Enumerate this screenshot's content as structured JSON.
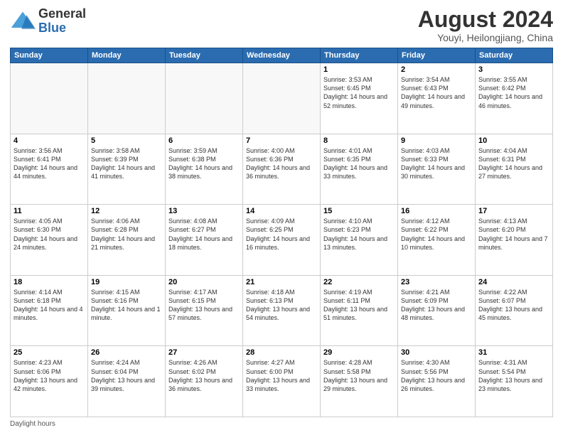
{
  "header": {
    "logo_general": "General",
    "logo_blue": "Blue",
    "month_year": "August 2024",
    "location": "Youyi, Heilongjiang, China"
  },
  "days_of_week": [
    "Sunday",
    "Monday",
    "Tuesday",
    "Wednesday",
    "Thursday",
    "Friday",
    "Saturday"
  ],
  "weeks": [
    [
      {
        "day": "",
        "info": ""
      },
      {
        "day": "",
        "info": ""
      },
      {
        "day": "",
        "info": ""
      },
      {
        "day": "",
        "info": ""
      },
      {
        "day": "1",
        "info": "Sunrise: 3:53 AM\nSunset: 6:45 PM\nDaylight: 14 hours and 52 minutes."
      },
      {
        "day": "2",
        "info": "Sunrise: 3:54 AM\nSunset: 6:43 PM\nDaylight: 14 hours and 49 minutes."
      },
      {
        "day": "3",
        "info": "Sunrise: 3:55 AM\nSunset: 6:42 PM\nDaylight: 14 hours and 46 minutes."
      }
    ],
    [
      {
        "day": "4",
        "info": "Sunrise: 3:56 AM\nSunset: 6:41 PM\nDaylight: 14 hours and 44 minutes."
      },
      {
        "day": "5",
        "info": "Sunrise: 3:58 AM\nSunset: 6:39 PM\nDaylight: 14 hours and 41 minutes."
      },
      {
        "day": "6",
        "info": "Sunrise: 3:59 AM\nSunset: 6:38 PM\nDaylight: 14 hours and 38 minutes."
      },
      {
        "day": "7",
        "info": "Sunrise: 4:00 AM\nSunset: 6:36 PM\nDaylight: 14 hours and 36 minutes."
      },
      {
        "day": "8",
        "info": "Sunrise: 4:01 AM\nSunset: 6:35 PM\nDaylight: 14 hours and 33 minutes."
      },
      {
        "day": "9",
        "info": "Sunrise: 4:03 AM\nSunset: 6:33 PM\nDaylight: 14 hours and 30 minutes."
      },
      {
        "day": "10",
        "info": "Sunrise: 4:04 AM\nSunset: 6:31 PM\nDaylight: 14 hours and 27 minutes."
      }
    ],
    [
      {
        "day": "11",
        "info": "Sunrise: 4:05 AM\nSunset: 6:30 PM\nDaylight: 14 hours and 24 minutes."
      },
      {
        "day": "12",
        "info": "Sunrise: 4:06 AM\nSunset: 6:28 PM\nDaylight: 14 hours and 21 minutes."
      },
      {
        "day": "13",
        "info": "Sunrise: 4:08 AM\nSunset: 6:27 PM\nDaylight: 14 hours and 18 minutes."
      },
      {
        "day": "14",
        "info": "Sunrise: 4:09 AM\nSunset: 6:25 PM\nDaylight: 14 hours and 16 minutes."
      },
      {
        "day": "15",
        "info": "Sunrise: 4:10 AM\nSunset: 6:23 PM\nDaylight: 14 hours and 13 minutes."
      },
      {
        "day": "16",
        "info": "Sunrise: 4:12 AM\nSunset: 6:22 PM\nDaylight: 14 hours and 10 minutes."
      },
      {
        "day": "17",
        "info": "Sunrise: 4:13 AM\nSunset: 6:20 PM\nDaylight: 14 hours and 7 minutes."
      }
    ],
    [
      {
        "day": "18",
        "info": "Sunrise: 4:14 AM\nSunset: 6:18 PM\nDaylight: 14 hours and 4 minutes."
      },
      {
        "day": "19",
        "info": "Sunrise: 4:15 AM\nSunset: 6:16 PM\nDaylight: 14 hours and 1 minute."
      },
      {
        "day": "20",
        "info": "Sunrise: 4:17 AM\nSunset: 6:15 PM\nDaylight: 13 hours and 57 minutes."
      },
      {
        "day": "21",
        "info": "Sunrise: 4:18 AM\nSunset: 6:13 PM\nDaylight: 13 hours and 54 minutes."
      },
      {
        "day": "22",
        "info": "Sunrise: 4:19 AM\nSunset: 6:11 PM\nDaylight: 13 hours and 51 minutes."
      },
      {
        "day": "23",
        "info": "Sunrise: 4:21 AM\nSunset: 6:09 PM\nDaylight: 13 hours and 48 minutes."
      },
      {
        "day": "24",
        "info": "Sunrise: 4:22 AM\nSunset: 6:07 PM\nDaylight: 13 hours and 45 minutes."
      }
    ],
    [
      {
        "day": "25",
        "info": "Sunrise: 4:23 AM\nSunset: 6:06 PM\nDaylight: 13 hours and 42 minutes."
      },
      {
        "day": "26",
        "info": "Sunrise: 4:24 AM\nSunset: 6:04 PM\nDaylight: 13 hours and 39 minutes."
      },
      {
        "day": "27",
        "info": "Sunrise: 4:26 AM\nSunset: 6:02 PM\nDaylight: 13 hours and 36 minutes."
      },
      {
        "day": "28",
        "info": "Sunrise: 4:27 AM\nSunset: 6:00 PM\nDaylight: 13 hours and 33 minutes."
      },
      {
        "day": "29",
        "info": "Sunrise: 4:28 AM\nSunset: 5:58 PM\nDaylight: 13 hours and 29 minutes."
      },
      {
        "day": "30",
        "info": "Sunrise: 4:30 AM\nSunset: 5:56 PM\nDaylight: 13 hours and 26 minutes."
      },
      {
        "day": "31",
        "info": "Sunrise: 4:31 AM\nSunset: 5:54 PM\nDaylight: 13 hours and 23 minutes."
      }
    ]
  ],
  "footer": {
    "note": "Daylight hours"
  }
}
